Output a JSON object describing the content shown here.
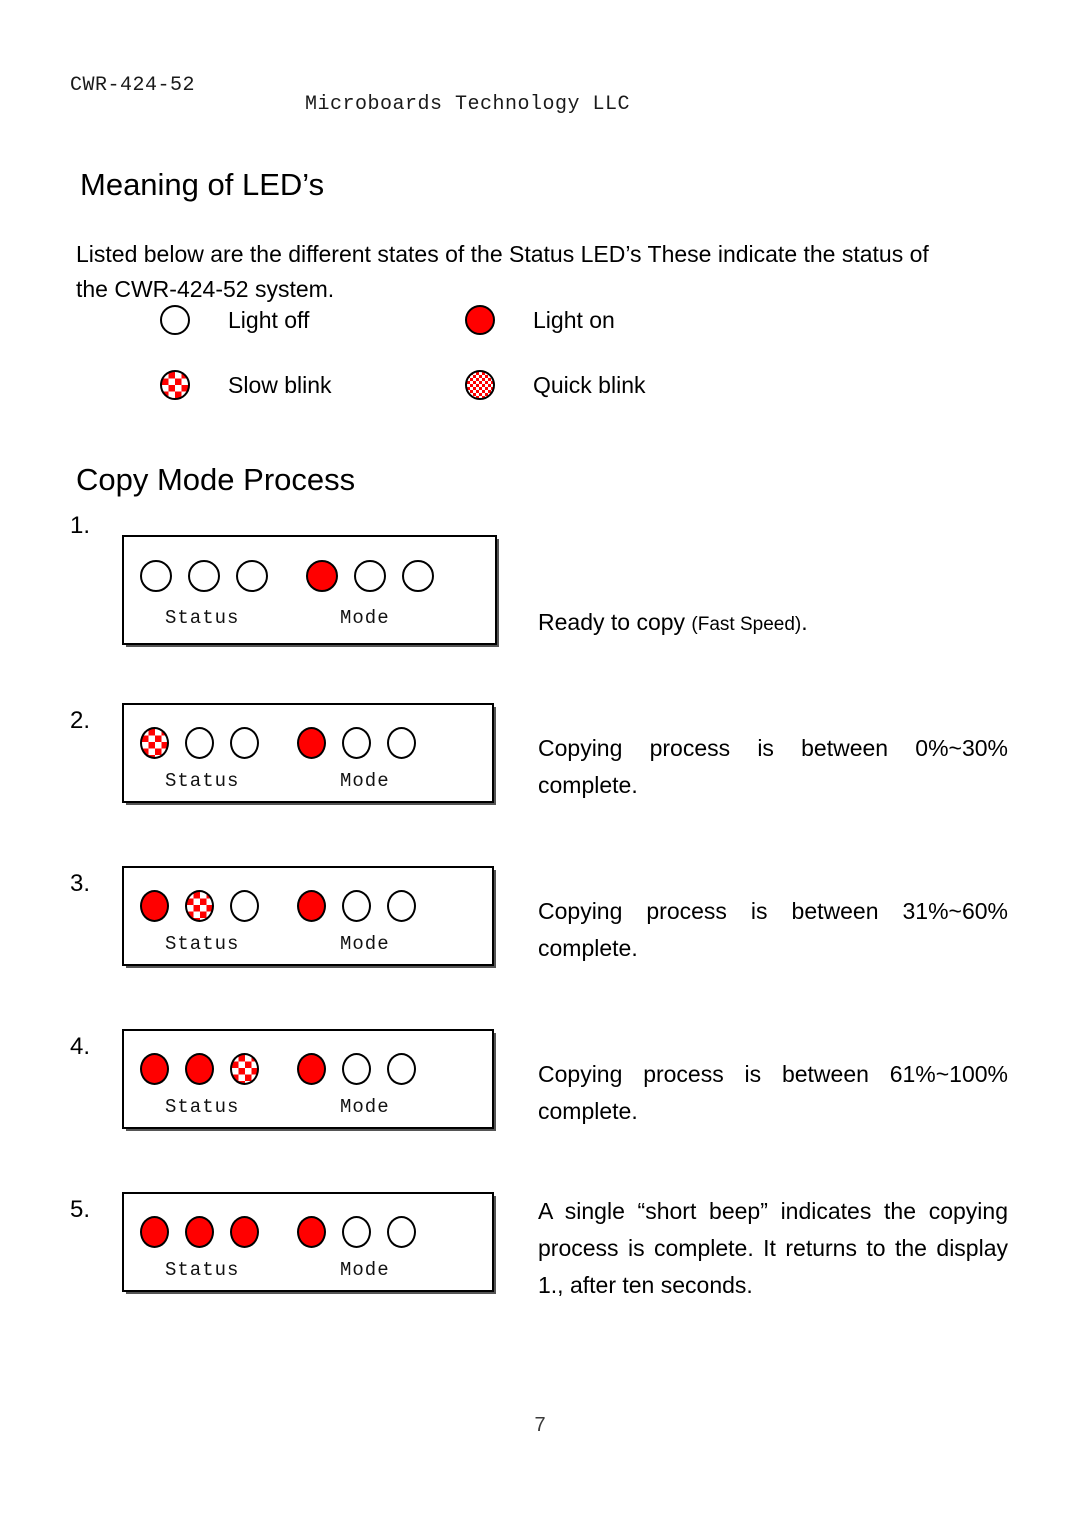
{
  "document": {
    "header_left": "CWR-424-52",
    "header_center": "Microboards Technology LLC",
    "page_number": "7"
  },
  "sections": {
    "leds": {
      "heading": "Meaning of LED’s",
      "intro": "Listed below are the different states of the Status  LED’s These indicate the status of the CWR-424-52 system.",
      "legend": [
        {
          "state": "off",
          "label": "Light off"
        },
        {
          "state": "on",
          "label": "Light on"
        },
        {
          "state": "slow",
          "label": "Slow blink"
        },
        {
          "state": "quick",
          "label": "Quick blink"
        }
      ]
    },
    "copy_mode": {
      "heading": "Copy Mode Process",
      "panel_labels": {
        "status": "Status",
        "mode": "Mode"
      },
      "steps": [
        {
          "number": "1.",
          "status_leds": [
            "off",
            "off",
            "off"
          ],
          "mode_leds": [
            "on",
            "off",
            "off"
          ],
          "description_main": "Ready to copy ",
          "description_small": "(Fast Speed)",
          "description_tail": "."
        },
        {
          "number": "2.",
          "status_leds": [
            "slow",
            "off",
            "off"
          ],
          "mode_leds": [
            "on",
            "off",
            "off"
          ],
          "description_main": "Copying process is between 0%~30% complete.",
          "description_small": "",
          "description_tail": ""
        },
        {
          "number": "3.",
          "status_leds": [
            "on",
            "slow",
            "off"
          ],
          "mode_leds": [
            "on",
            "off",
            "off"
          ],
          "description_main": "Copying process is between 31%~60% complete.",
          "description_small": "",
          "description_tail": ""
        },
        {
          "number": "4.",
          "status_leds": [
            "on",
            "on",
            "slow"
          ],
          "mode_leds": [
            "on",
            "off",
            "off"
          ],
          "description_main": "Copying process is between 61%~100% complete.",
          "description_small": "",
          "description_tail": ""
        },
        {
          "number": "5.",
          "status_leds": [
            "on",
            "on",
            "on"
          ],
          "mode_leds": [
            "on",
            "off",
            "off"
          ],
          "description_main": "A single “short beep” indicates the copying process is complete. It returns to the display 1., after ten seconds.",
          "description_small": "",
          "description_tail": ""
        }
      ]
    }
  },
  "colors": {
    "led_on": "#ff0000",
    "led_off": "#ffffff",
    "outline": "#000000",
    "text": "#000000"
  }
}
